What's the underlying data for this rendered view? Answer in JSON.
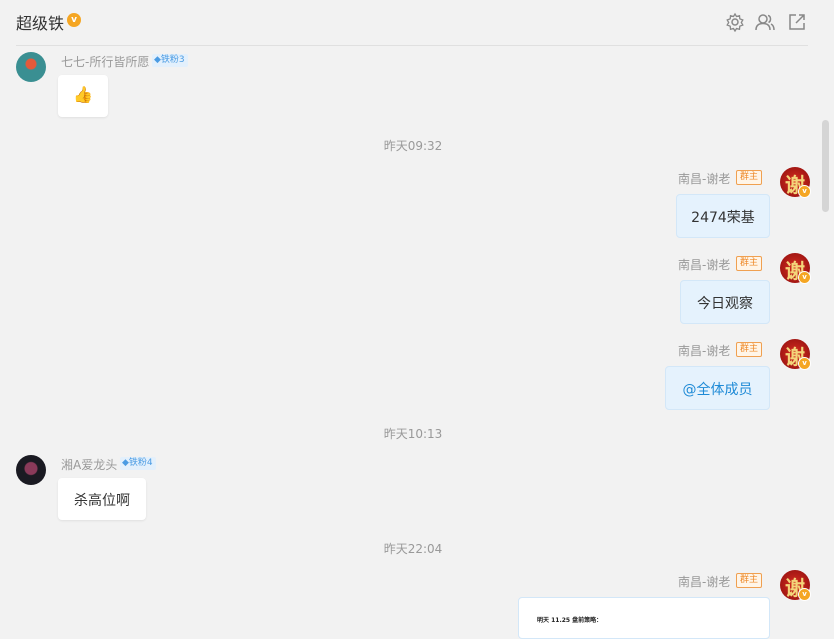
{
  "header": {
    "title": "超级铁",
    "title_badge": "v",
    "icons": [
      "settings-icon",
      "members-icon",
      "popout-icon"
    ]
  },
  "messages": {
    "m1": {
      "sender": "七七-所行皆所愿",
      "level_tag": "铁粉3",
      "content": "👍"
    },
    "t1": "昨天09:32",
    "m2": {
      "sender": "南昌-谢老",
      "role_tag": "群主",
      "avatar_char": "谢",
      "content": "2474荣基"
    },
    "m3": {
      "sender": "南昌-谢老",
      "role_tag": "群主",
      "avatar_char": "谢",
      "content": "今日观察"
    },
    "m4": {
      "sender": "南昌-谢老",
      "role_tag": "群主",
      "avatar_char": "谢",
      "content": "@全体成员"
    },
    "t2": "昨天10:13",
    "m5": {
      "sender": "湘A爱龙头",
      "level_tag": "铁粉4",
      "content": "杀高位啊"
    },
    "t3": "昨天22:04",
    "m6": {
      "sender": "南昌-谢老",
      "role_tag": "群主",
      "avatar_char": "谢",
      "image_caption": "明天 11.25 盘前策略："
    }
  },
  "colors": {
    "background": "#f2f2f2",
    "own_bubble": "#e5f2fd",
    "mention": "#1e8ad6",
    "owner_tag": "#ee8a2a",
    "fan_tag": "#4a9be3"
  }
}
